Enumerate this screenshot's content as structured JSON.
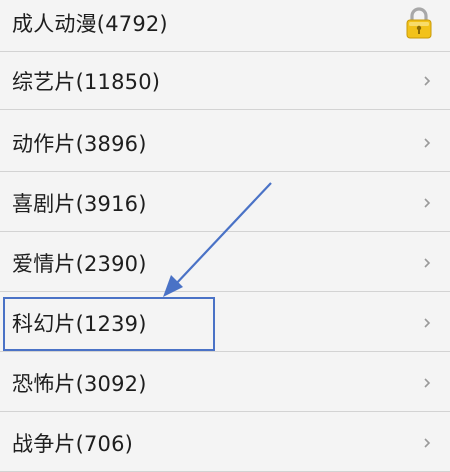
{
  "categories": [
    {
      "label": "成人动漫(4792)",
      "trailing_icon": "lock-icon"
    },
    {
      "label": "综艺片(11850)",
      "trailing_icon": "chevron-right-icon"
    },
    {
      "label": "动作片(3896)",
      "trailing_icon": "chevron-right-icon"
    },
    {
      "label": "喜剧片(3916)",
      "trailing_icon": "chevron-right-icon"
    },
    {
      "label": "爱情片(2390)",
      "trailing_icon": "chevron-right-icon"
    },
    {
      "label": "科幻片(1239)",
      "trailing_icon": "chevron-right-icon"
    },
    {
      "label": "恐怖片(3092)",
      "trailing_icon": "chevron-right-icon"
    },
    {
      "label": "战争片(706)",
      "trailing_icon": "chevron-right-icon"
    }
  ],
  "highlighted_index": 5,
  "colors": {
    "background": "#f4f4f4",
    "divider": "#d3d3d3",
    "text": "#1e1e1e",
    "chevron": "#9a9a9a",
    "annotation": "#4a72c6",
    "lock_body": "#f2c21a"
  }
}
